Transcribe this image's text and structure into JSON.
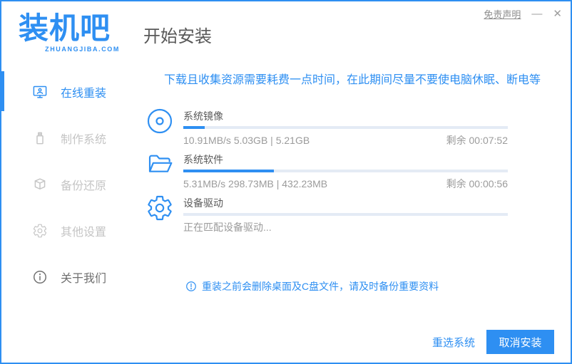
{
  "window": {
    "logo_title": "装机吧",
    "logo_subtitle": "ZHUANGJIBA.COM",
    "page_title": "开始安装",
    "disclaimer": "免责声明",
    "minimize_glyph": "—",
    "close_glyph": "✕"
  },
  "sidebar": {
    "items": [
      {
        "label": "在线重装",
        "icon": "monitor-user-icon",
        "active": true
      },
      {
        "label": "制作系统",
        "icon": "usb-drive-icon",
        "active": false
      },
      {
        "label": "备份还原",
        "icon": "backup-box-icon",
        "active": false
      },
      {
        "label": "其他设置",
        "icon": "gear-icon",
        "active": false
      },
      {
        "label": "关于我们",
        "icon": "info-icon",
        "active": false
      }
    ]
  },
  "main": {
    "warning": "下载且收集资源需要耗费一点时间，在此期间尽量不要使电脑休眠、断电等",
    "tasks": [
      {
        "name": "系统镜像",
        "detail": "10.91MB/s 5.03GB | 5.21GB",
        "remaining": "剩余 00:07:52",
        "progress": 6.5,
        "icon": "disc-icon"
      },
      {
        "name": "系统软件",
        "detail": "5.31MB/s 298.73MB | 432.23MB",
        "remaining": "剩余 00:00:56",
        "progress": 28,
        "icon": "folder-icon"
      },
      {
        "name": "设备驱动",
        "detail": "正在匹配设备驱动...",
        "remaining": "",
        "progress": 0,
        "icon": "gear-icon"
      }
    ],
    "note": "重装之前会删除桌面及C盘文件，请及时备份重要资料",
    "reselect_label": "重选系统",
    "cancel_label": "取消安装"
  },
  "colors": {
    "accent": "#2e8ff2",
    "track": "#e4ebf5"
  }
}
